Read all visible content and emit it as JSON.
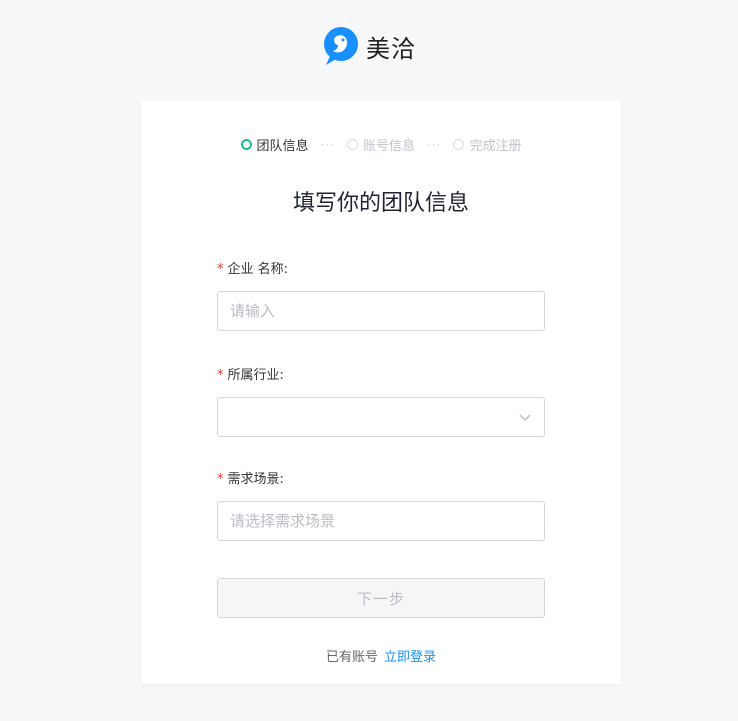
{
  "brand": {
    "name": "美洽",
    "logo_icon": "meiqia-bird-logo",
    "accent": "#1890ff"
  },
  "steps": [
    {
      "label": "团队信息",
      "state": "active"
    },
    {
      "label": "账号信息",
      "state": "pending"
    },
    {
      "label": "完成注册",
      "state": "pending"
    }
  ],
  "step_separator": "···",
  "title": "填写你的团队信息",
  "form": {
    "company_name": {
      "label": "企业 名称:",
      "required_mark": "*",
      "value": "",
      "placeholder": "请输入"
    },
    "industry": {
      "label": "所属行业:",
      "required_mark": "*",
      "value": "",
      "icon": "chevron-down-icon"
    },
    "scenario": {
      "label": "需求场景:",
      "required_mark": "*",
      "value": "",
      "placeholder": "请选择需求场景"
    }
  },
  "next_button": {
    "label": "下一步",
    "state": "disabled"
  },
  "login": {
    "prompt": "已有账号",
    "link_label": "立即登录",
    "link_color": "#1890ff"
  },
  "colors": {
    "active_step": "#1abc9c",
    "required": "#e5322d",
    "background": "#f7f8fa"
  }
}
